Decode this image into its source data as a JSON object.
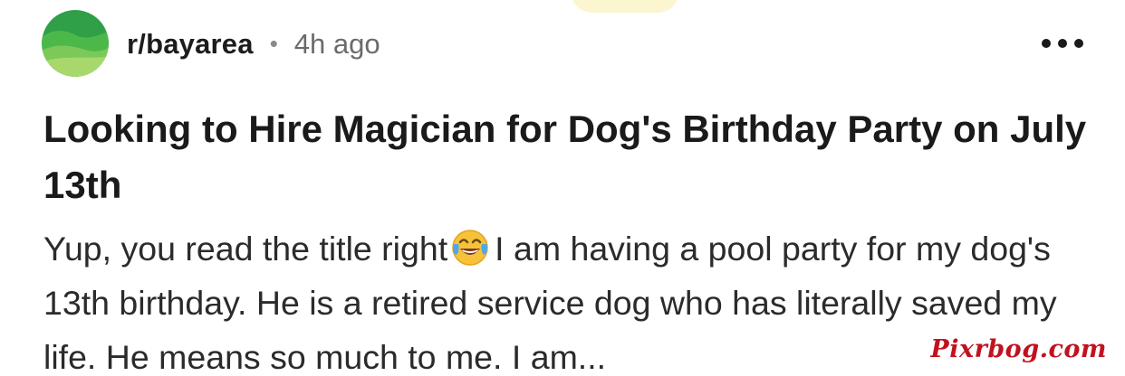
{
  "header": {
    "subreddit": "r/bayarea",
    "separator": "•",
    "time": "4h ago",
    "avatar_icon": "community-landscape-icon",
    "more_icon": "more-options-icon"
  },
  "post": {
    "title": "Looking to Hire Magician for Dog's Birthday Party on July 13th",
    "body_before_emoji": "Yup, you read the title right",
    "emoji_icon": "tears-of-joy-emoji",
    "body_after_emoji": "I am having a pool party for my dog's 13th birthday. He is a retired service dog who has literally saved my life. He means so much to me. I am..."
  },
  "watermark": {
    "text": "Pixrbog.com"
  },
  "colors": {
    "text": "#1a1a1b",
    "muted": "#6b6b6b",
    "avatar_green": "#3fae3a",
    "avatar_light": "#9ed36a",
    "watermark": "#c1121f"
  }
}
